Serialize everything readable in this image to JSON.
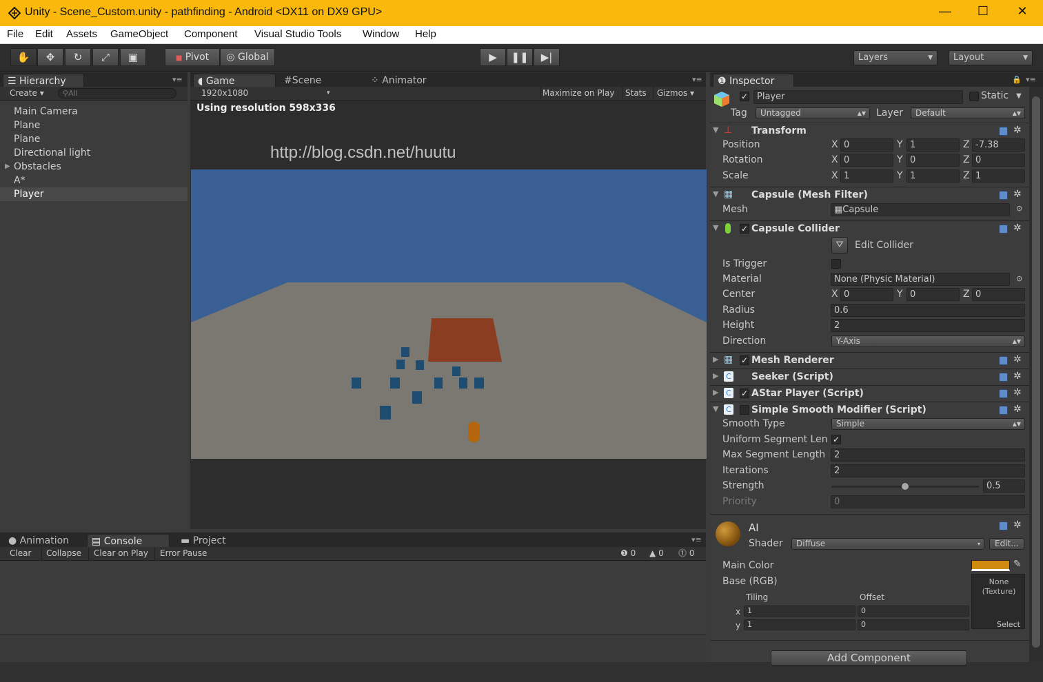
{
  "window": {
    "title": "Unity - Scene_Custom.unity - pathfinding - Android <DX11 on DX9 GPU>",
    "minimize": "—",
    "maximize": "☐",
    "close": "✕"
  },
  "menu": [
    "File",
    "Edit",
    "Assets",
    "GameObject",
    "Component",
    "Visual Studio Tools",
    "Window",
    "Help"
  ],
  "toolbar": {
    "pivot": "Pivot",
    "global": "Global",
    "layers": "Layers",
    "layout": "Layout"
  },
  "hierarchy": {
    "tab": "Hierarchy",
    "create": "Create",
    "search_placeholder": "All",
    "items": [
      "Main Camera",
      "Plane",
      "Plane",
      "Directional light",
      "Obstacles",
      "A*",
      "Player"
    ],
    "selected": "Player"
  },
  "game": {
    "tabs": [
      "Game",
      "Scene",
      "Animator"
    ],
    "resolution": "1920x1080",
    "maximize": "Maximize on Play",
    "stats": "Stats",
    "gizmos": "Gizmos",
    "info": "Using resolution 598x336",
    "watermark": "http://blog.csdn.net/huutu"
  },
  "console": {
    "tabs": [
      "Animation",
      "Console",
      "Project"
    ],
    "buttons": [
      "Clear",
      "Collapse",
      "Clear on Play",
      "Error Pause"
    ],
    "counts": [
      "0",
      "0",
      "0"
    ]
  },
  "inspector": {
    "tab": "Inspector",
    "name": "Player",
    "static": "Static",
    "tag_label": "Tag",
    "tag": "Untagged",
    "layer_label": "Layer",
    "layer": "Default",
    "transform": {
      "title": "Transform",
      "rows": [
        {
          "label": "Position",
          "x": "0",
          "y": "1",
          "z": "-7.38"
        },
        {
          "label": "Rotation",
          "x": "0",
          "y": "0",
          "z": "0"
        },
        {
          "label": "Scale",
          "x": "1",
          "y": "1",
          "z": "1"
        }
      ]
    },
    "mesh_filter": {
      "title": "Capsule (Mesh Filter)",
      "mesh_label": "Mesh",
      "mesh": "Capsule"
    },
    "collider": {
      "title": "Capsule Collider",
      "edit": "Edit Collider",
      "is_trigger": "Is Trigger",
      "material_label": "Material",
      "material": "None (Physic Material)",
      "center": "Center",
      "cx": "0",
      "cy": "0",
      "cz": "0",
      "radius_label": "Radius",
      "radius": "0.6",
      "height_label": "Height",
      "height": "2",
      "direction_label": "Direction",
      "direction": "Y-Axis"
    },
    "mesh_renderer": "Mesh Renderer",
    "seeker": "Seeker (Script)",
    "astar": "AStar Player (Script)",
    "smooth": {
      "title": "Simple Smooth Modifier (Script)",
      "type_label": "Smooth Type",
      "type": "Simple",
      "uniform_label": "Uniform Segment Len",
      "max_label": "Max Segment Length",
      "max": "2",
      "iter_label": "Iterations",
      "iter": "2",
      "strength_label": "Strength",
      "strength": "0.5",
      "strength_level": 0.5,
      "priority_label": "Priority",
      "priority": "0"
    },
    "material": {
      "name": "AI",
      "shader_label": "Shader",
      "shader": "Diffuse",
      "edit": "Edit...",
      "main_color": "Main Color",
      "color": "#d08a10",
      "base": "Base (RGB)",
      "none_tex": "None (Texture)",
      "select": "Select",
      "tiling": "Tiling",
      "offset": "Offset",
      "tx": "1",
      "ty": "1",
      "ox": "0",
      "oy": "0"
    },
    "add_component": "Add Component"
  }
}
